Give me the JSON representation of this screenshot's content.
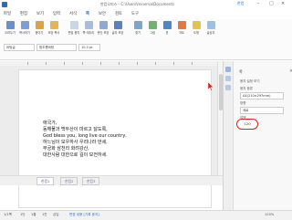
{
  "window": {
    "title": "한컴오피스 - C:\\Users\\minerva\\Documents",
    "tab_label": "한컴"
  },
  "menu": [
    "파일",
    "편집",
    "보기",
    "입력",
    "서식",
    "쪽",
    "보안",
    "검토",
    "도구"
  ],
  "ribbon": {
    "buttons": [
      "오려두기",
      "복사하기",
      "붙이기",
      "모양 복사",
      "편집 용지",
      "쪽 테두리",
      "문단 모양",
      "글자 모양",
      "찾기",
      "그림",
      "표",
      "차트",
      "도형",
      "글상자"
    ]
  },
  "format_bar": {
    "style": "바탕글",
    "font": "함초롬바탕",
    "size": "10.0 pt"
  },
  "document": {
    "lines": [
      "애국가,",
      "동해물과 백두산이 마르고 닳도록,",
      "God bless you, long live our country,",
      "하느님이 보우하사 우리나라 만세,",
      "무궁화 삼천리 화려강산,",
      "대한사람 대한으로 길이 보전하세."
    ]
  },
  "tabs": [
    "한컴1",
    "한컴2",
    "한컴3"
  ],
  "status": {
    "page": "1/1쪽",
    "section": "1단",
    "line": "1줄",
    "col": "1칸",
    "mode": "삽입",
    "change": "변경 내용 [기록 중지]",
    "zoom": "120%"
  },
  "panel": {
    "title": "쪽",
    "section1": "용지 설정 보기",
    "paper_label": "용지 종류",
    "paper_value": "A4(210×297mm)",
    "orient_label": "방향",
    "orient_value": "세로",
    "margin_label": "여백",
    "scale_label": "배율",
    "scale_value": "120"
  },
  "colors": {
    "accent": "#2c6cc4",
    "highlight": "#e02020"
  }
}
